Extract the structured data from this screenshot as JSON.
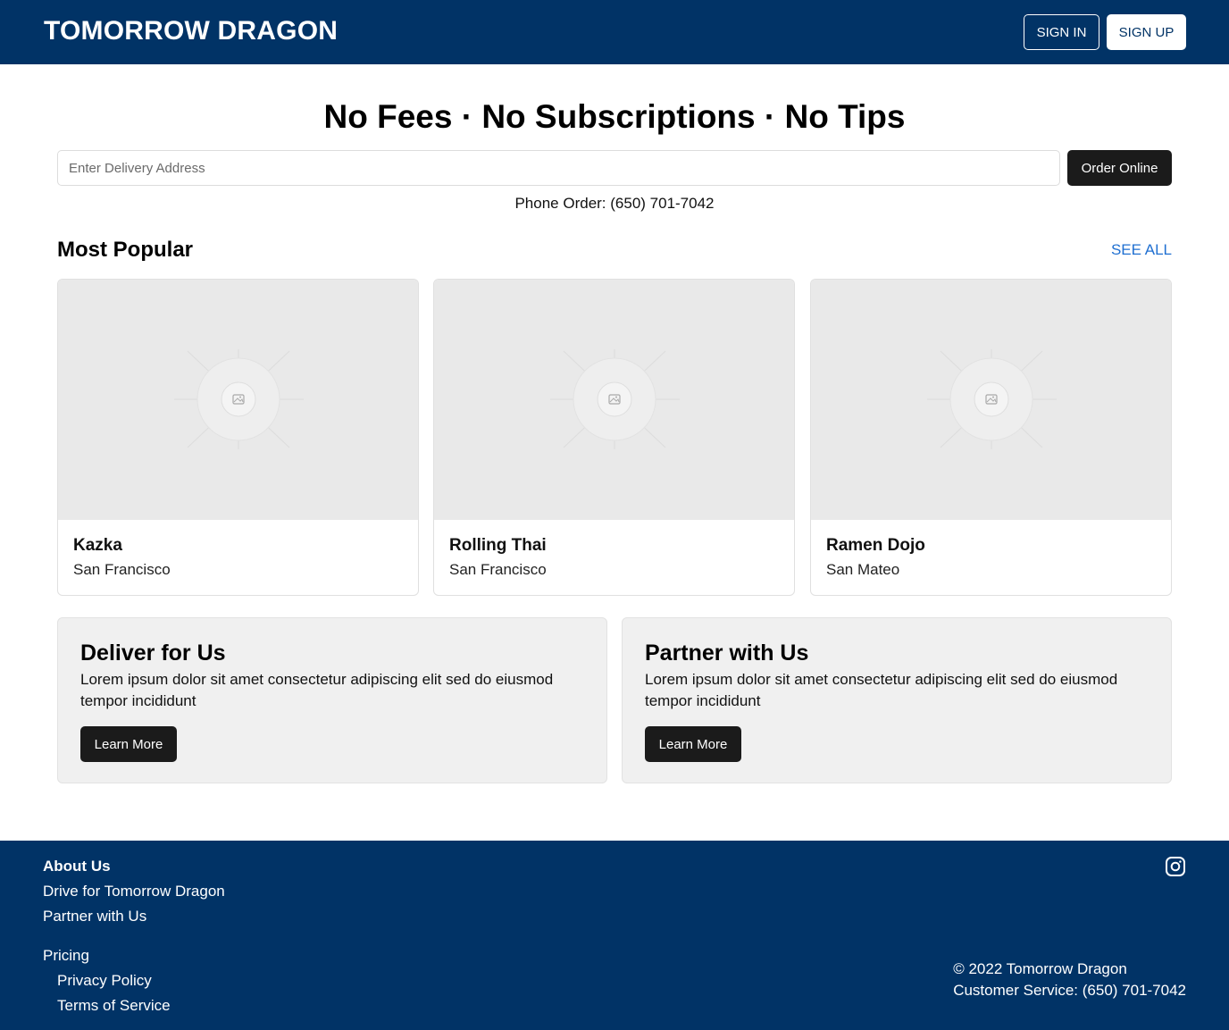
{
  "header": {
    "brand": "TOMORROW DRAGON",
    "sign_in": "SIGN IN",
    "sign_up": "SIGN UP",
    "bg_color": "#013366"
  },
  "hero": {
    "title": "No Fees · No Subscriptions · No Tips",
    "address_placeholder": "Enter Delivery Address",
    "address_value": "",
    "order_button": "Order Online",
    "phone_order": "Phone Order: (650) 701-7042"
  },
  "popular": {
    "title": "Most Popular",
    "see_all": "SEE ALL",
    "restaurants": [
      {
        "name": "Kazka",
        "city": "San Francisco",
        "image_icon": "image-placeholder-icon"
      },
      {
        "name": "Rolling Thai",
        "city": "San Francisco",
        "image_icon": "image-placeholder-icon"
      },
      {
        "name": "Ramen Dojo",
        "city": "San Mateo",
        "image_icon": "image-placeholder-icon"
      }
    ]
  },
  "promos": [
    {
      "title": "Deliver for Us",
      "description": "Lorem ipsum dolor sit amet consectetur adipiscing elit sed do eiusmod tempor incididunt",
      "button": "Learn More"
    },
    {
      "title": "Partner with Us",
      "description": "Lorem ipsum dolor sit amet consectetur adipiscing elit sed do eiusmod tempor incididunt",
      "button": "Learn More"
    }
  ],
  "footer": {
    "about": "About Us",
    "drive": "Drive for Tomorrow Dragon",
    "partner": "Partner with Us",
    "pricing": "Pricing",
    "privacy": "Privacy Policy",
    "terms": "Terms of Service",
    "copyright": "© 2022 Tomorrow Dragon",
    "customer_service": "Customer Service: (650) 701-7042",
    "social_icon": "instagram-icon"
  },
  "colors": {
    "brand_navy": "#013366",
    "dark_button": "#1b1b1b",
    "link_blue": "#1f6fd1",
    "promo_bg": "#f0f0f0"
  }
}
